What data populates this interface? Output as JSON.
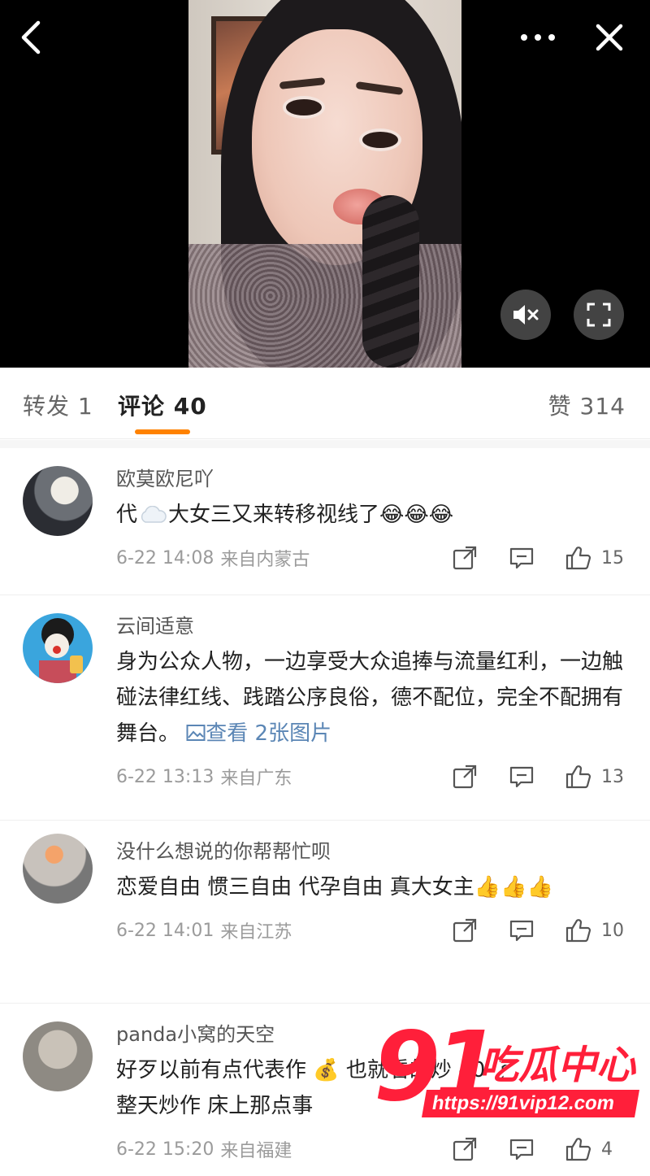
{
  "tabs": {
    "repost_label": "转发 1",
    "comment_label": "评论 40",
    "like_label": "赞 314",
    "accent_color": "#ff8200"
  },
  "video": {
    "controls": [
      "back-icon",
      "more-icon",
      "close-icon",
      "mute-icon",
      "fullscreen-icon"
    ]
  },
  "comments": [
    {
      "username": "欧莫欧尼吖",
      "text_parts": [
        "代",
        "大女三又来转移视线了",
        "😂😂😂"
      ],
      "time": "6-22 14:08",
      "location": "来自内蒙古",
      "likes": "15"
    },
    {
      "username": "云间适意",
      "text": "身为公众人物，一边享受大众追捧与流量红利，一边触碰法律红线、践踏公序良俗，德不配位，完全不配拥有舞台。",
      "image_link": "查看 2张图片",
      "time": "6-22 13:13",
      "location": "来自广东",
      "likes": "13"
    },
    {
      "username": "没什么想说的你帮帮忙呗",
      "text": "恋爱自由 惯三自由 代孕自由 真大女主",
      "emoji": "👍👍👍",
      "time": "6-22 14:01",
      "location": "来自江苏",
      "likes": "10"
    },
    {
      "username": "panda小窝的天空",
      "text_a": "好歹以前有点代表作",
      "emoji_a": "💰",
      "text_b": "也就看的炒 40 了",
      "text_c": "整天炒作 床上那点事",
      "time": "6-22 15:20",
      "location": "来自福建",
      "likes": "4"
    }
  ],
  "watermark": {
    "number": "91",
    "title": "吃瓜中心",
    "url": "https://91vip12.com"
  }
}
